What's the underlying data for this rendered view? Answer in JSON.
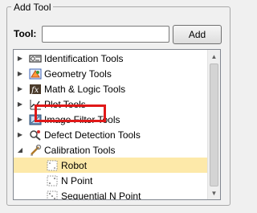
{
  "group": {
    "title": "Add Tool"
  },
  "search": {
    "label": "Tool:",
    "value": "",
    "placeholder": ""
  },
  "add_button": {
    "label": "Add"
  },
  "tree": {
    "items": [
      {
        "label": "Identification Tools",
        "icon": "identification-icon",
        "expander": "collapsed"
      },
      {
        "label": "Geometry Tools",
        "icon": "geometry-icon",
        "expander": "collapsed"
      },
      {
        "label": "Math & Logic Tools",
        "icon": "math-logic-icon",
        "expander": "collapsed"
      },
      {
        "label": "Plot Tools",
        "icon": "plot-icon",
        "expander": "collapsed"
      },
      {
        "label": "Image Filter Tools",
        "icon": "image-filter-icon",
        "expander": "collapsed"
      },
      {
        "label": "Defect Detection Tools",
        "icon": "defect-detection-icon",
        "expander": "collapsed"
      },
      {
        "label": "Calibration Tools",
        "icon": "calibration-icon",
        "expander": "expanded"
      },
      {
        "label": "Robot",
        "icon": "robot-calibration-icon",
        "selected": true
      },
      {
        "label": "N Point",
        "icon": "n-point-icon"
      },
      {
        "label": "Sequential N Point",
        "icon": "sequential-n-point-icon"
      }
    ]
  },
  "colors": {
    "selected_row": "#fde9a9",
    "highlight_border": "#e01818"
  }
}
